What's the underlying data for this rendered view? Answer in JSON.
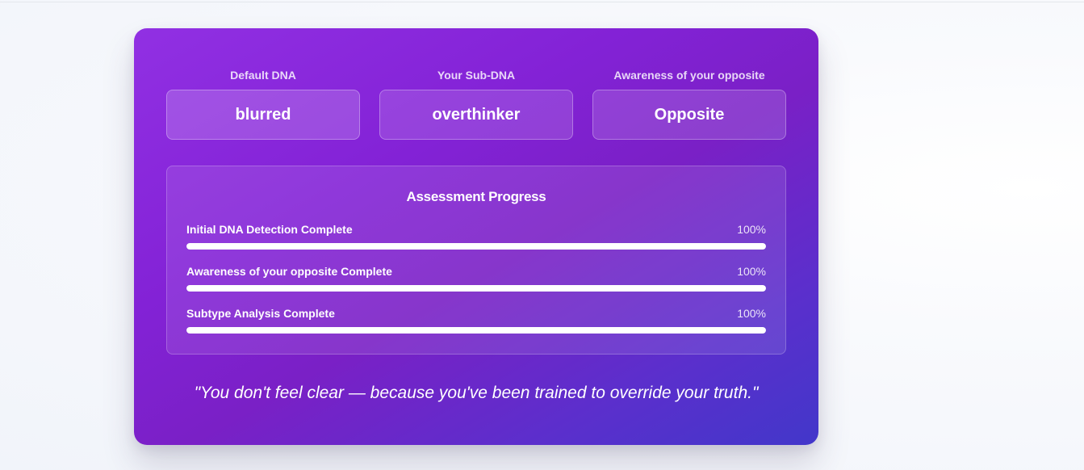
{
  "dna": [
    {
      "label": "Default DNA",
      "value": "blurred"
    },
    {
      "label": "Your Sub-DNA",
      "value": "overthinker"
    },
    {
      "label": "Awareness of your opposite",
      "value": "Opposite"
    }
  ],
  "progress": {
    "title": "Assessment Progress",
    "items": [
      {
        "label": "Initial DNA Detection Complete",
        "value_text": "100%",
        "percent": 100
      },
      {
        "label": "Awareness of your opposite Complete",
        "value_text": "100%",
        "percent": 100
      },
      {
        "label": "Subtype Analysis Complete",
        "value_text": "100%",
        "percent": 100
      }
    ]
  },
  "quote": "\"You don't feel clear — because you've been trained to override your truth.\"",
  "colors": {
    "card_gradient_start": "#9130e3",
    "card_gradient_end": "#4237ca",
    "progress_fill": "#ffffff"
  }
}
